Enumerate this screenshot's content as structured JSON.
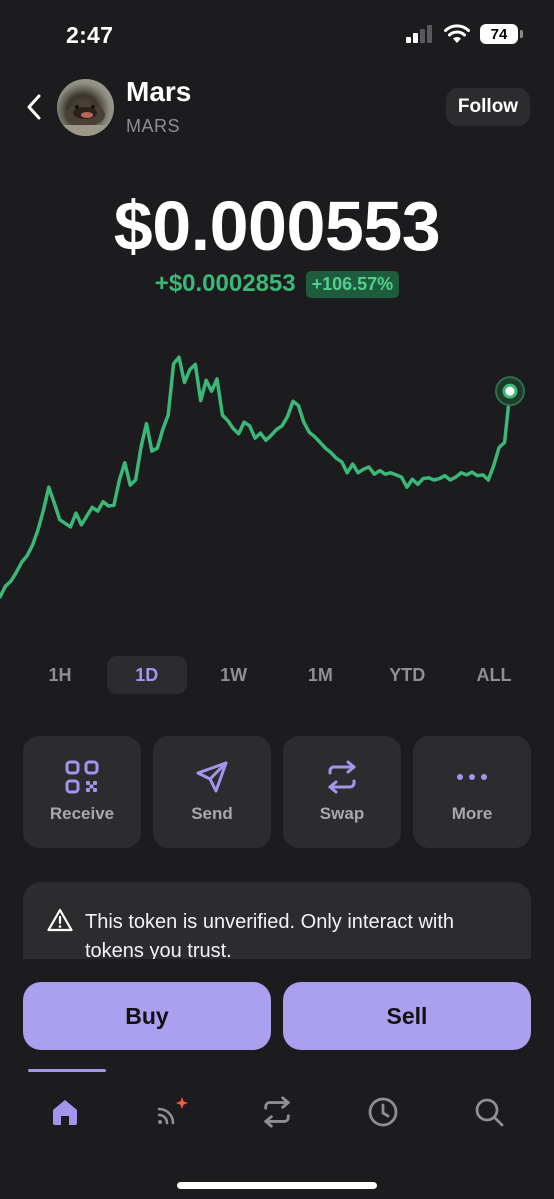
{
  "status_bar": {
    "time": "2:47",
    "battery": "74"
  },
  "header": {
    "name": "Mars",
    "symbol": "MARS",
    "follow_label": "Follow"
  },
  "price": {
    "value": "$0.000553",
    "change_amount": "+$0.0002853",
    "change_percent": "+106.57%"
  },
  "ranges": {
    "options": [
      "1H",
      "1D",
      "1W",
      "1M",
      "YTD",
      "ALL"
    ],
    "selected": "1D"
  },
  "actions": [
    {
      "label": "Receive",
      "icon": "qr-code-icon"
    },
    {
      "label": "Send",
      "icon": "paper-plane-icon"
    },
    {
      "label": "Swap",
      "icon": "swap-arrows-icon"
    },
    {
      "label": "More",
      "icon": "more-dots-icon"
    }
  ],
  "warning": {
    "text": "This token is unverified. Only interact with tokens you trust."
  },
  "trade": {
    "buy_label": "Buy",
    "sell_label": "Sell"
  },
  "tabs": [
    {
      "icon": "home-icon",
      "active": true
    },
    {
      "icon": "explore-feed-icon",
      "active": false,
      "badge": true
    },
    {
      "icon": "swap-icon",
      "active": false
    },
    {
      "icon": "history-icon",
      "active": false
    },
    {
      "icon": "search-icon",
      "active": false
    }
  ],
  "colors": {
    "accent": "#ab9ff0",
    "positive": "#3bb878",
    "background": "#1c1c1e",
    "card": "#2c2c2e"
  },
  "chart_data": {
    "type": "line",
    "x": [
      0,
      1,
      2,
      3,
      4,
      5,
      6,
      7,
      8,
      9,
      10,
      11,
      12,
      13,
      14,
      15,
      16,
      17,
      18,
      19,
      20,
      21,
      22,
      23,
      24,
      25,
      26,
      27,
      28,
      29,
      30,
      31,
      32,
      33,
      34,
      35,
      36,
      37,
      38,
      39,
      40,
      41,
      42,
      43,
      44,
      45,
      46,
      47,
      48,
      49,
      50,
      51,
      52,
      53,
      54,
      55,
      56,
      57,
      58,
      59,
      60,
      61,
      62,
      63,
      64,
      65,
      66,
      67,
      68,
      69,
      70,
      71,
      72,
      73,
      74,
      75,
      76,
      77,
      78,
      79,
      80,
      81,
      82,
      83,
      84,
      85,
      86,
      87,
      88,
      89,
      90,
      91,
      92,
      93,
      94,
      95,
      96,
      97,
      98,
      99,
      100,
      101,
      102,
      103,
      104,
      105,
      106,
      107,
      108,
      109,
      110,
      111,
      112,
      113,
      114,
      115,
      116,
      117,
      118,
      119
    ],
    "values": [
      0.000268,
      0.000283,
      0.00029,
      0.000302,
      0.000316,
      0.000325,
      0.00034,
      0.000361,
      0.000388,
      0.00042,
      0.000398,
      0.000375,
      0.00037,
      0.000365,
      0.000384,
      0.000368,
      0.00038,
      0.000392,
      0.000387,
      0.0004,
      0.000394,
      0.000395,
      0.00043,
      0.000454,
      0.000423,
      0.00043,
      0.000476,
      0.000508,
      0.00047,
      0.000474,
      0.0005,
      0.00052,
      0.000591,
      0.0006,
      0.000565,
      0.000583,
      0.00059,
      0.00054,
      0.000568,
      0.000553,
      0.00057,
      0.00052,
      0.000512,
      0.000501,
      0.000494,
      0.00051,
      0.000505,
      0.000488,
      0.000495,
      0.000485,
      0.000492,
      0.0005,
      0.000505,
      0.000518,
      0.000539,
      0.000533,
      0.00051,
      0.000496,
      0.00049,
      0.000482,
      0.000474,
      0.000468,
      0.00046,
      0.000455,
      0.00044,
      0.000452,
      0.00044,
      0.000445,
      0.000448,
      0.000438,
      0.000443,
      0.000438,
      0.00044,
      0.000437,
      0.000434,
      0.00042,
      0.000431,
      0.000424,
      0.000432,
      0.000433,
      0.00043,
      0.000432,
      0.000436,
      0.00043,
      0.000434,
      0.00044,
      0.000437,
      0.000441,
      0.000436,
      0.000437,
      0.00043,
      0.00045,
      0.000475,
      0.000482,
      0.000553
    ],
    "title": "",
    "xlabel": "",
    "ylabel": "",
    "ylim": [
      0.00025,
      0.00061
    ],
    "grid": false,
    "end_marker": true
  }
}
